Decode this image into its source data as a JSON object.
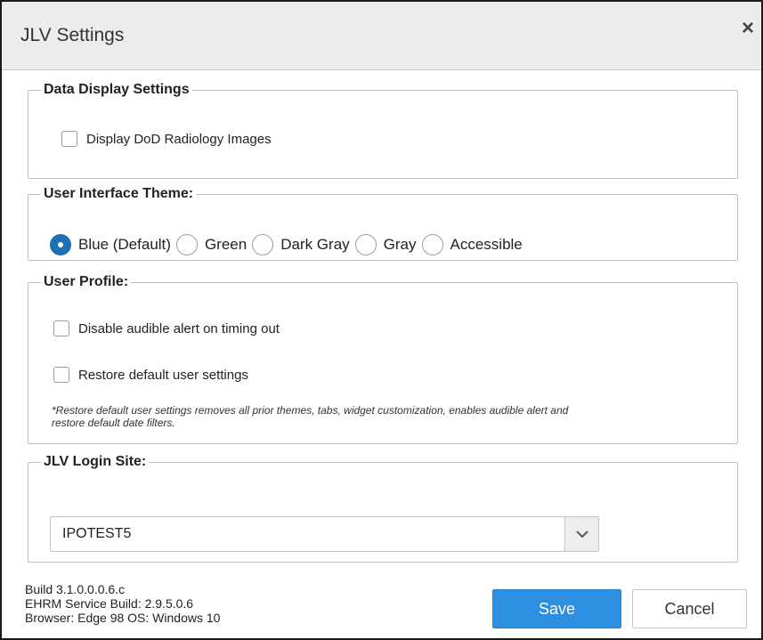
{
  "dialog": {
    "title": "JLV Settings",
    "close_symbol": "×"
  },
  "data_display": {
    "legend": "Data Display Settings",
    "radiology_label": "Display DoD Radiology Images",
    "radiology_checked": false
  },
  "theme": {
    "legend": "User Interface Theme:",
    "options": [
      {
        "label": "Blue (Default)",
        "checked": true
      },
      {
        "label": "Green",
        "checked": false
      },
      {
        "label": "Dark Gray",
        "checked": false
      },
      {
        "label": "Gray",
        "checked": false
      },
      {
        "label": "Accessible",
        "checked": false
      }
    ]
  },
  "profile": {
    "legend": "User Profile:",
    "disable_alert_label": "Disable audible alert on timing out",
    "restore_defaults_label": "Restore default user settings",
    "note_line1": "*Restore default user settings removes all prior themes, tabs, widget customization, enables audible alert and",
    "note_line2": "restore default date filters."
  },
  "login": {
    "legend": "JLV Login Site:",
    "selected_site": "IPOTEST5"
  },
  "footer": {
    "build": "Build 3.1.0.0.0.6.c",
    "ehrm_build": "EHRM Service Build: 2.9.5.0.6",
    "browser": "Browser: Edge 98 OS: Windows 10",
    "save_label": "Save",
    "cancel_label": "Cancel"
  },
  "colors": {
    "accent": "#2d8fe0",
    "radio_checked": "#1f6fb5",
    "titlebar": "#ececec"
  }
}
